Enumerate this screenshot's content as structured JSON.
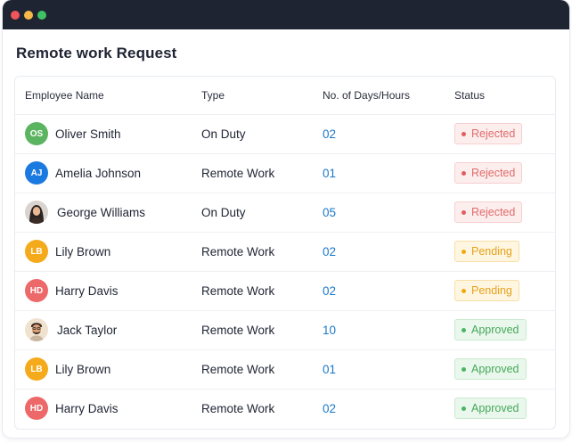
{
  "title": "Remote work Request",
  "colors": {
    "titlebar": "#1f2433",
    "days": "#1a78c9",
    "rejected": "#e06a6a",
    "pending": "#e5a11a",
    "approved": "#45a85a"
  },
  "columns": {
    "name": "Employee Name",
    "type": "Type",
    "days": "No. of Days/Hours",
    "status": "Status"
  },
  "rows": [
    {
      "initials": "OS",
      "avatar_color": "#5bb45f",
      "photo": false,
      "name": "Oliver Smith",
      "type": "On Duty",
      "days": "02",
      "status": "Rejected",
      "status_key": "rejected"
    },
    {
      "initials": "AJ",
      "avatar_color": "#1a7ae0",
      "photo": false,
      "name": "Amelia Johnson",
      "type": "Remote Work",
      "days": "01",
      "status": "Rejected",
      "status_key": "rejected"
    },
    {
      "initials": "",
      "avatar_color": "#6f5a4c",
      "photo": true,
      "photo_icon": "woman-avatar-photo",
      "name": "George Williams",
      "type": "On Duty",
      "days": "05",
      "status": "Rejected",
      "status_key": "rejected"
    },
    {
      "initials": "LB",
      "avatar_color": "#f4aa1a",
      "photo": false,
      "name": "Lily Brown",
      "type": "Remote Work",
      "days": "02",
      "status": "Pending",
      "status_key": "pending"
    },
    {
      "initials": "HD",
      "avatar_color": "#ed6868",
      "photo": false,
      "name": "Harry Davis",
      "type": "Remote Work",
      "days": "02",
      "status": "Pending",
      "status_key": "pending"
    },
    {
      "initials": "",
      "avatar_color": "#e7d3b8",
      "photo": true,
      "photo_icon": "man-avatar-photo",
      "name": "Jack Taylor",
      "type": "Remote Work",
      "days": "10",
      "status": "Approved",
      "status_key": "approved"
    },
    {
      "initials": "LB",
      "avatar_color": "#f4aa1a",
      "photo": false,
      "name": "Lily Brown",
      "type": "Remote Work",
      "days": "01",
      "status": "Approved",
      "status_key": "approved"
    },
    {
      "initials": "HD",
      "avatar_color": "#ed6868",
      "photo": false,
      "name": "Harry Davis",
      "type": "Remote Work",
      "days": "02",
      "status": "Approved",
      "status_key": "approved"
    }
  ]
}
